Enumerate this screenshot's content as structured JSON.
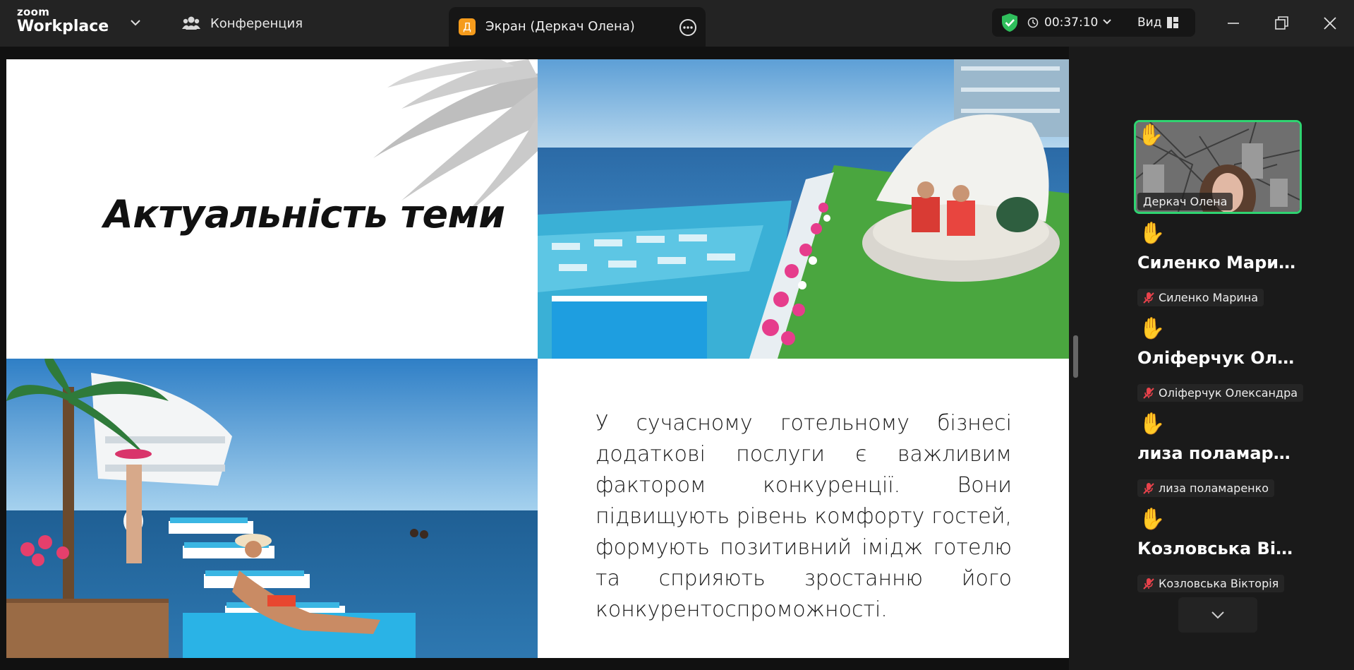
{
  "app": {
    "logo_top": "zoom",
    "logo_bottom": "Workplace"
  },
  "header": {
    "conference_label": "Конференция",
    "screen_tab": {
      "badge": "Д",
      "label": "Экран (Деркач Олена)"
    },
    "timer": "00:37:10",
    "view_label": "Вид"
  },
  "slide": {
    "title": "Актуальність теми",
    "body": "У сучасному готельному бізнесі додаткові послуги є важливим фактором конкуренції. Вони підвищують рівень комфорту гостей, формують позитивний імідж готелю та сприяють зростанню його конкурентоспроможності."
  },
  "participants": {
    "active": {
      "name": "Деркач Олена"
    },
    "list": [
      {
        "display": "Силенко Марина",
        "tag": "Силенко Марина"
      },
      {
        "display": "Оліферчук Оле...",
        "tag": "Оліферчук Олександра"
      },
      {
        "display": "лиза поламаре...",
        "tag": "лиза поламаренко"
      },
      {
        "display": "Козловська Вік...",
        "tag": "Козловська Вікторія"
      }
    ]
  },
  "colors": {
    "accent_green": "#2fd371",
    "badge_orange": "#f59b1c",
    "muted_red": "#e8424b"
  },
  "icons": [
    "chevron-down-icon",
    "participants-icon",
    "more-options-icon",
    "shield-check-icon",
    "clock-icon",
    "view-grid-icon",
    "minimize-icon",
    "restore-icon",
    "close-icon",
    "raised-hand-icon",
    "mic-muted-icon"
  ]
}
